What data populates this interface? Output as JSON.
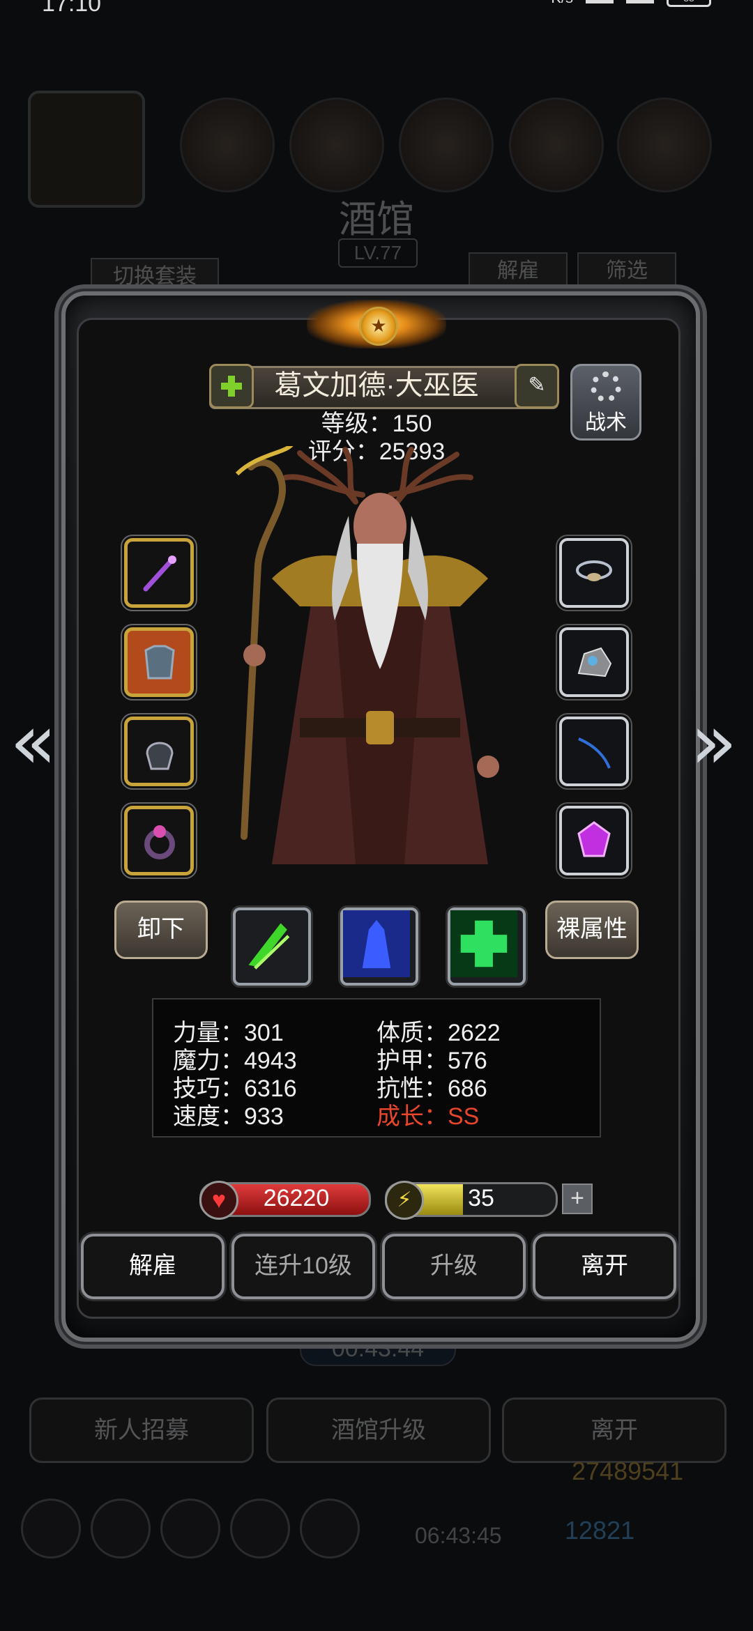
{
  "status_bar": {
    "time": "17:10",
    "net": "K/s",
    "battery": "88"
  },
  "background": {
    "title": "酒馆",
    "level": "LV.77",
    "switch_outfit": "切换套装",
    "dismiss": "解雇",
    "filter": "筛选",
    "timer": "00:43:44",
    "recruit": "新人招募",
    "upgrade_tavern": "酒馆升级",
    "leave": "离开",
    "gold": "27489541",
    "gems": "12821",
    "timer2": "06:43:45"
  },
  "hero": {
    "name": "葛文加德·大巫医",
    "level": "等级：150",
    "score": "评分：25393",
    "tactics_label": "战术"
  },
  "equipment": {
    "left": [
      "staff-icon",
      "chest-armor-icon",
      "helmet-icon",
      "ring-icon"
    ],
    "right": [
      "amulet-icon",
      "stone-icon",
      "bow-icon",
      "purple-gem-icon"
    ]
  },
  "buttons": {
    "unequip": "卸下",
    "base_attributes": "裸属性"
  },
  "skills": [
    "green-claw-skill-icon",
    "blue-shadow-skill-icon",
    "green-cross-skill-icon"
  ],
  "stats": {
    "strength": "力量：301",
    "magic": "魔力：4943",
    "skill": "技巧：6316",
    "speed": "速度：933",
    "constitution": "体质：2622",
    "armor": "护甲：576",
    "resistance": "抗性：686",
    "growth": "成长：SS"
  },
  "bars": {
    "hp": "26220",
    "energy": "35",
    "energy_fill": 0.45
  },
  "actions": {
    "dismiss": "解雇",
    "level10": "连升10级",
    "levelup": "升级",
    "leave": "离开"
  },
  "colors": {
    "growth": "#e8462c",
    "hp": "#e03b3b",
    "energy": "#f1e45b"
  }
}
